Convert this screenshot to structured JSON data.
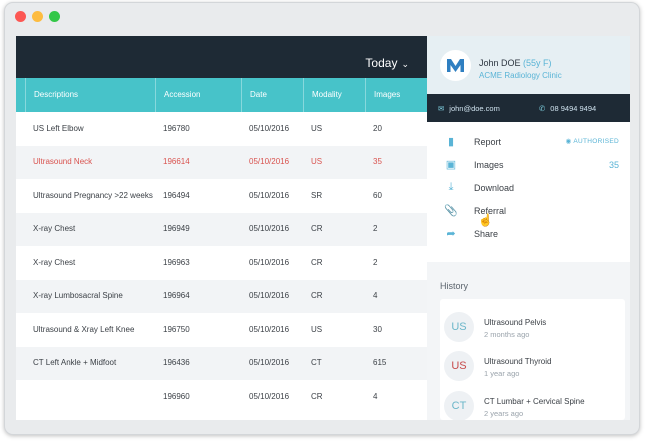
{
  "window": {
    "controls": [
      "close",
      "minimize",
      "maximize"
    ]
  },
  "toolbar": {
    "date_filter": "Today",
    "chevron_icon": "chevron-down-icon"
  },
  "table": {
    "columns": [
      "Descriptions",
      "Accession",
      "Date",
      "Modality",
      "Images"
    ],
    "rows": [
      {
        "description": "US Left Elbow",
        "accession": "196780",
        "date": "05/10/2016",
        "modality": "US",
        "images": "20"
      },
      {
        "description": "Ultrasound Neck",
        "accession": "196614",
        "date": "05/10/2016",
        "modality": "US",
        "images": "35"
      },
      {
        "description": "Ultrasound Pregnancy >22 weeks",
        "accession": "196494",
        "date": "05/10/2016",
        "modality": "SR",
        "images": "60"
      },
      {
        "description": "X-ray Chest",
        "accession": "196949",
        "date": "05/10/2016",
        "modality": "CR",
        "images": "2"
      },
      {
        "description": "X-ray Chest",
        "accession": "196963",
        "date": "05/10/2016",
        "modality": "CR",
        "images": "2"
      },
      {
        "description": "X-ray Lumbosacral Spine",
        "accession": "196964",
        "date": "05/10/2016",
        "modality": "CR",
        "images": "4"
      },
      {
        "description": "Ultrasound & Xray Left Knee",
        "accession": "196750",
        "date": "05/10/2016",
        "modality": "US",
        "images": "30"
      },
      {
        "description": "CT Left Ankle + Midfoot",
        "accession": "196436",
        "date": "05/10/2016",
        "modality": "CT",
        "images": "615"
      },
      {
        "description": "",
        "accession": "196960",
        "date": "05/10/2016",
        "modality": "CR",
        "images": "4"
      }
    ]
  },
  "patient": {
    "name": "John DOE",
    "age_sex": "(55y F)",
    "clinic": "ACME Radiology Clinic",
    "email": "john@doe.com",
    "phone": "08 9494 9494"
  },
  "actions": {
    "report": "Report",
    "report_status": "AUTHORISED",
    "images": "Images",
    "images_count": "35",
    "download": "Download",
    "referral": "Referral",
    "share": "Share"
  },
  "history": {
    "title": "History",
    "items": [
      {
        "avatar": "US",
        "title": "Ultrasound Pelvis",
        "date": "2 months ago"
      },
      {
        "avatar": "US",
        "title": "Ultrasound Thyroid",
        "date": "1 year ago"
      },
      {
        "avatar": "CT",
        "title": "CT Lumbar + Cervical Spine",
        "date": "2 years ago"
      }
    ]
  },
  "colors": {
    "header_dark": "#1e2a35",
    "teal": "#47c3c9",
    "accent_blue": "#5ab4d6",
    "highlight_red": "#d9534f"
  }
}
